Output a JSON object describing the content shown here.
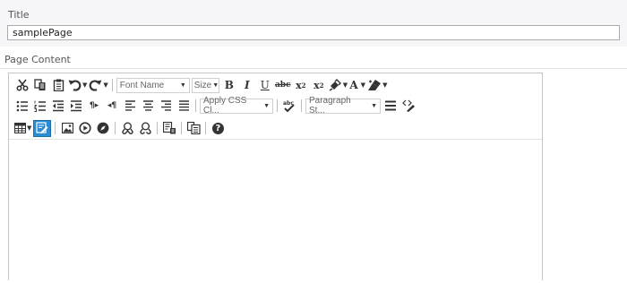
{
  "title_field": {
    "label": "Title",
    "value": "samplePage"
  },
  "content": {
    "label": "Page Content"
  },
  "toolbar": {
    "font_name": "Font Name",
    "font_size": "Size",
    "bold": "B",
    "italic": "I",
    "underline": "U",
    "strikethrough": "abc",
    "subscript_base": "x",
    "subscript_mark": "2",
    "superscript_base": "x",
    "superscript_mark": "2",
    "font_color": "A",
    "css_class": "Apply CSS Cl...",
    "paragraph_style": "Paragraph St...",
    "ltr": "¶▸",
    "rtl": "◂¶",
    "help": "?"
  },
  "colors": {
    "active_button": "#2a8dd4",
    "panel_background": "#f6f6f8",
    "editor_border": "#c6c6c6"
  }
}
